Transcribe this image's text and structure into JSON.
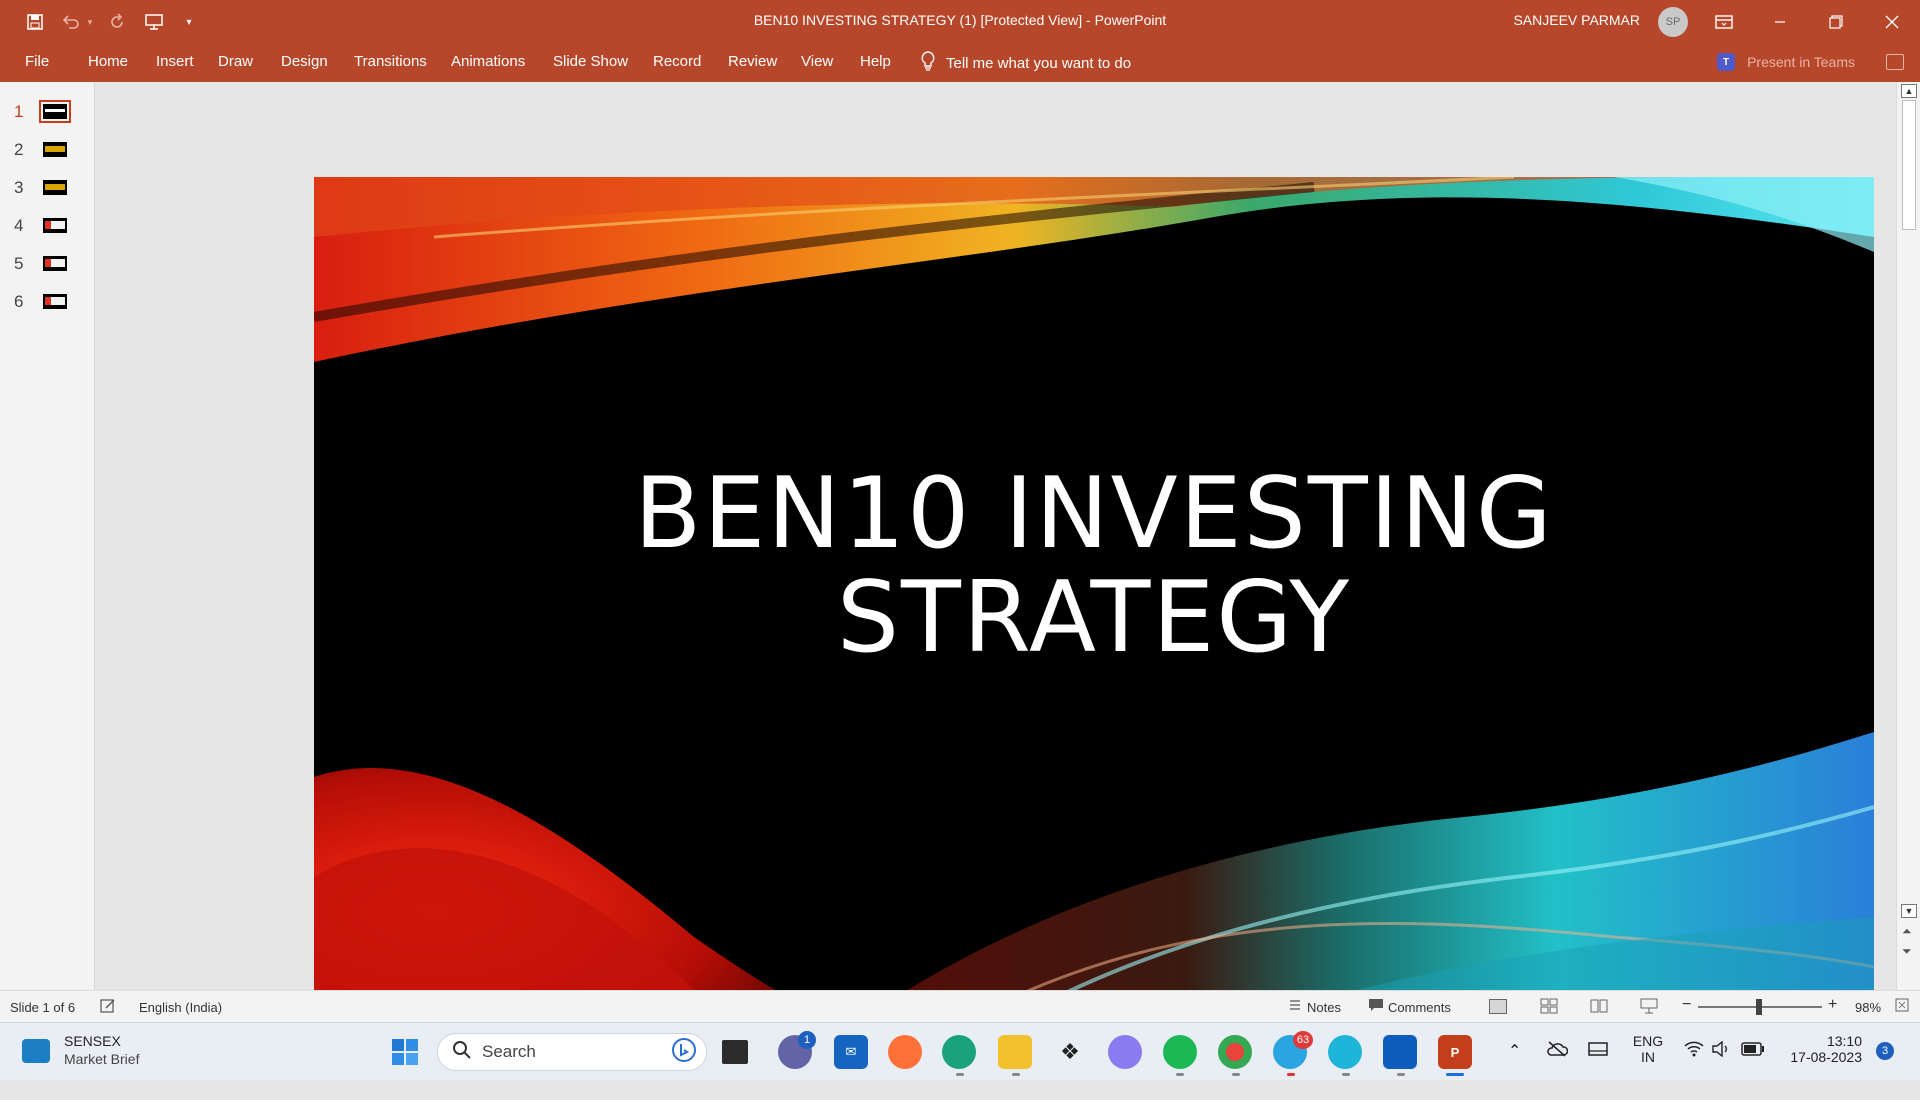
{
  "window": {
    "title": "BEN10 INVESTING STRATEGY (1) [Protected View]  -  PowerPoint",
    "user_name": "SANJEEV PARMAR",
    "user_initials": "SP"
  },
  "ribbon": {
    "tabs": [
      "File",
      "Home",
      "Insert",
      "Draw",
      "Design",
      "Transitions",
      "Animations",
      "Slide Show",
      "Record",
      "Review",
      "View",
      "Help"
    ],
    "tell_me": "Tell me what you want to do",
    "present_in_teams": "Present in Teams",
    "teams_badge": "T"
  },
  "thumbnails": {
    "numbers": [
      "1",
      "2",
      "3",
      "4",
      "5",
      "6"
    ],
    "active_index": 0
  },
  "slide": {
    "title_line1": "BEN10 INVESTING",
    "title_line2": "STRATEGY"
  },
  "statusbar": {
    "slide_info": "Slide 1 of 6",
    "language": "English (India)",
    "notes": "Notes",
    "comments": "Comments",
    "zoom": "98%"
  },
  "taskbar": {
    "news_title": "SENSEX",
    "news_subtitle": "Market Brief",
    "search_placeholder": "Search",
    "teams_badge": "1",
    "telegram_badge": "63",
    "lang_line1": "ENG",
    "lang_line2": "IN",
    "time": "13:10",
    "date": "17-08-2023",
    "notification_count": "3"
  }
}
